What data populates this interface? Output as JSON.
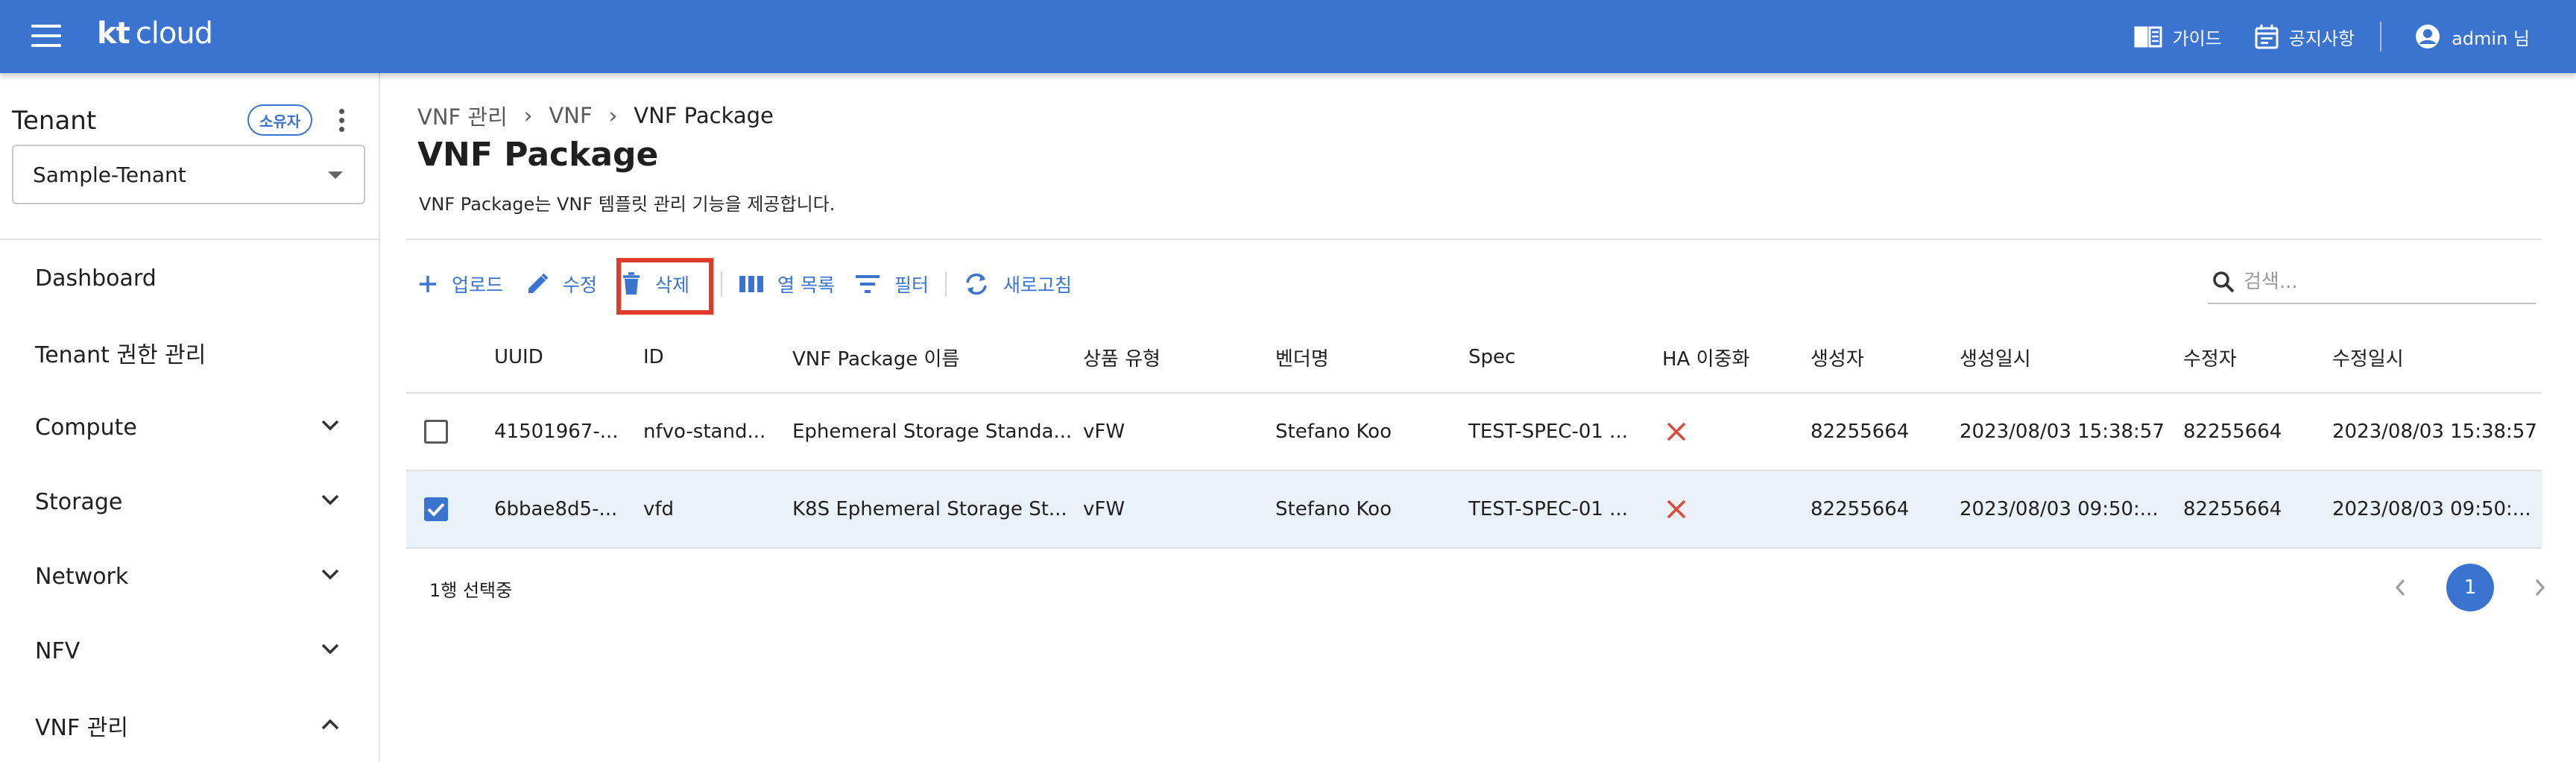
{
  "header": {
    "logo_kt": "kt",
    "logo_cloud": "cloud",
    "guide_label": "가이드",
    "notice_label": "공지사항",
    "user_label": "admin 님"
  },
  "sidebar": {
    "tenant_title": "Tenant",
    "owner_badge": "소유자",
    "tenant_selected": "Sample-Tenant",
    "items": [
      {
        "label": "Dashboard",
        "chevron": ""
      },
      {
        "label": "Tenant 권한 관리",
        "chevron": ""
      },
      {
        "label": "Compute",
        "chevron": "down"
      },
      {
        "label": "Storage",
        "chevron": "down"
      },
      {
        "label": "Network",
        "chevron": "down"
      },
      {
        "label": "NFV",
        "chevron": "down"
      },
      {
        "label": "VNF 관리",
        "chevron": "up"
      }
    ]
  },
  "breadcrumb": [
    "VNF 관리",
    "VNF",
    "VNF Package"
  ],
  "page": {
    "title": "VNF Package",
    "description": "VNF Package는 VNF 템플릿 관리 기능을 제공합니다."
  },
  "toolbar": {
    "upload": "업로드",
    "edit": "수정",
    "delete": "삭제",
    "columns": "열 목록",
    "filter": "필터",
    "refresh": "새로고침"
  },
  "search": {
    "placeholder": "검색..."
  },
  "table": {
    "headers": [
      "UUID",
      "ID",
      "VNF Package 이름",
      "상품 유형",
      "벤더명",
      "Spec",
      "HA 이중화",
      "생성자",
      "생성일시",
      "수정자",
      "수정일시"
    ],
    "rows": [
      {
        "selected": false,
        "uuid": "41501967-...",
        "id": "nfvo-stand...",
        "name": "Ephemeral Storage Standa...",
        "product_type": "vFW",
        "vendor": "Stefano Koo",
        "spec": "TEST-SPEC-01 ...",
        "ha": "x",
        "creator": "82255664",
        "created_at": "2023/08/03 15:38:57",
        "modifier": "82255664",
        "modified_at": "2023/08/03 15:38:57"
      },
      {
        "selected": true,
        "uuid": "6bbae8d5-...",
        "id": "vfd",
        "name": "K8S Ephemeral Storage St...",
        "product_type": "vFW",
        "vendor": "Stefano Koo",
        "spec": "TEST-SPEC-01 ...",
        "ha": "x",
        "creator": "82255664",
        "created_at": "2023/08/03 09:50:...",
        "modifier": "82255664",
        "modified_at": "2023/08/03 09:50:..."
      }
    ]
  },
  "footer": {
    "selected_text": "1행 선택중",
    "current_page": "1"
  },
  "colors": {
    "accent": "#3a73d0",
    "highlight": "#e03a2a",
    "error_x": "#e0483a",
    "selected_row": "#ebf1f9"
  }
}
